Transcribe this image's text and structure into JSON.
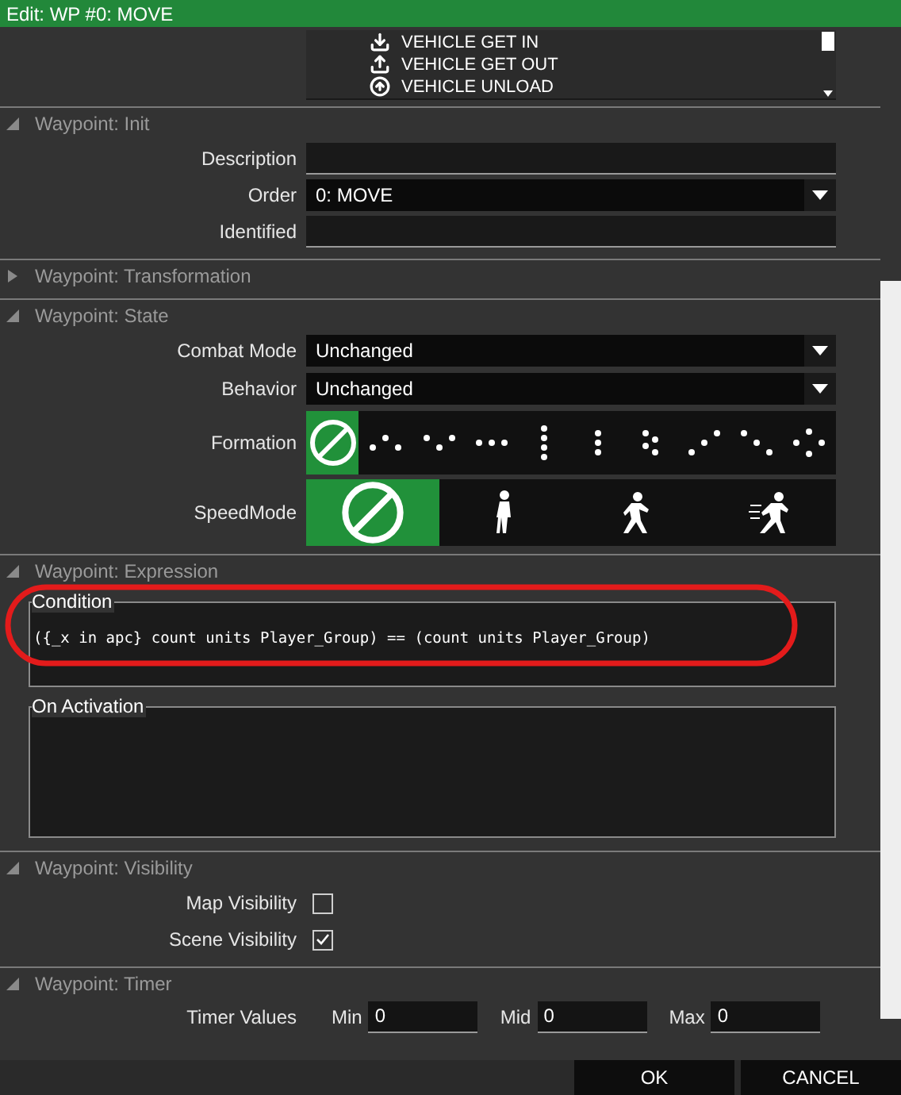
{
  "window": {
    "title": "Edit: WP #0: MOVE"
  },
  "waypoint_type_list": {
    "items": [
      {
        "label": "VEHICLE GET IN",
        "kind": "get-in"
      },
      {
        "label": "VEHICLE GET OUT",
        "kind": "get-out"
      },
      {
        "label": "VEHICLE UNLOAD",
        "kind": "unload"
      }
    ]
  },
  "sections": [
    {
      "kind": "init",
      "title": "Waypoint: Init",
      "expanded": true,
      "description": {
        "label": "Description"
      },
      "order": {
        "label": "Order",
        "value": "0: MOVE"
      },
      "identified": {
        "label": "Identified"
      }
    },
    {
      "title": "Waypoint: Transformation",
      "expanded": false
    },
    {
      "kind": "state",
      "title": "Waypoint: State",
      "expanded": true,
      "combat_mode": {
        "label": "Combat Mode",
        "value": "Unchanged"
      },
      "behavior": {
        "label": "Behavior",
        "value": "Unchanged"
      },
      "formation": {
        "label": "Formation",
        "options": [
          {
            "kind": "none",
            "selected": true
          },
          {
            "kind": "wedge",
            "selected": false
          },
          {
            "kind": "vee",
            "selected": false
          },
          {
            "kind": "line",
            "selected": false
          },
          {
            "kind": "column",
            "selected": false
          },
          {
            "kind": "file",
            "selected": false
          },
          {
            "kind": "stag-column",
            "selected": false
          },
          {
            "kind": "echelon-left",
            "selected": false
          },
          {
            "kind": "echelon-right",
            "selected": false
          },
          {
            "kind": "diamond",
            "selected": false
          }
        ]
      },
      "speed_mode": {
        "label": "SpeedMode",
        "options": [
          {
            "kind": "none",
            "selected": true
          },
          {
            "kind": "limited",
            "selected": false
          },
          {
            "kind": "normal",
            "selected": false
          },
          {
            "kind": "full",
            "selected": false
          }
        ]
      }
    },
    {
      "kind": "expression",
      "title": "Waypoint: Expression",
      "expanded": true,
      "condition": {
        "label": "Condition",
        "value": "({_x in apc} count units Player_Group) == (count units Player_Group)",
        "highlighted": true
      },
      "on_activation": {
        "label": "On Activation"
      }
    },
    {
      "kind": "visibility",
      "title": "Waypoint: Visibility",
      "expanded": true,
      "options": [
        {
          "label": "Map Visibility",
          "checked": false
        },
        {
          "label": "Scene Visibility",
          "checked": true
        }
      ]
    },
    {
      "kind": "timer",
      "title": "Waypoint: Timer",
      "expanded": true,
      "label": "Timer Values",
      "values": [
        {
          "label": "Min",
          "value": "0"
        },
        {
          "label": "Mid",
          "value": "0"
        },
        {
          "label": "Max",
          "value": "0"
        }
      ]
    }
  ],
  "buttons": [
    {
      "label": "OK"
    },
    {
      "label": "CANCEL"
    }
  ]
}
